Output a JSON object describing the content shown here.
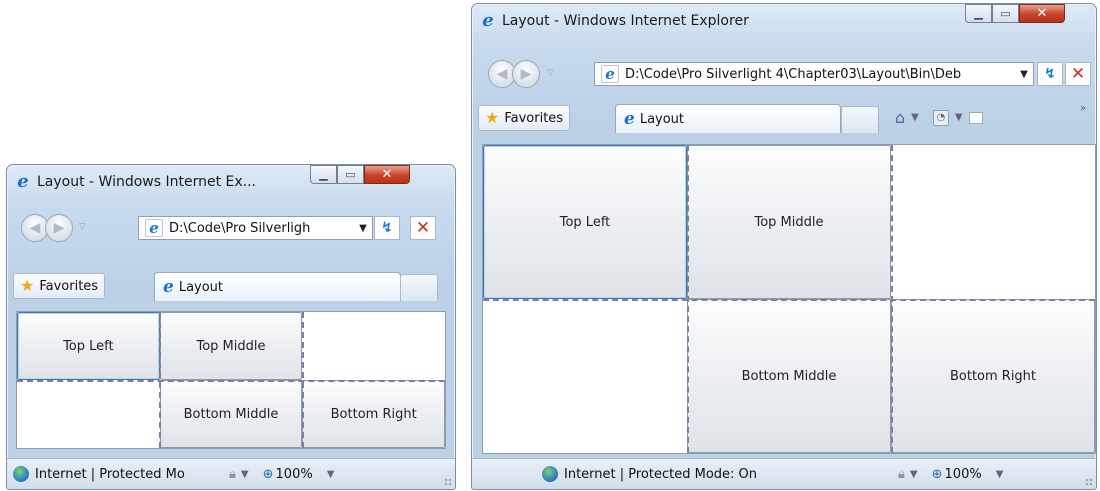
{
  "small_window": {
    "title": "Layout - Windows Internet Ex...",
    "address": "D:\\Code\\Pro Silverligh",
    "favorites_label": "Favorites",
    "tab_label": "Layout",
    "buttons": {
      "top_left": "Top Left",
      "top_middle": "Top Middle",
      "bottom_middle": "Bottom Middle",
      "bottom_right": "Bottom Right"
    },
    "status_text": "Internet | Protected Mo",
    "zoom": "100%"
  },
  "large_window": {
    "title": "Layout - Windows Internet Explorer",
    "address": "D:\\Code\\Pro Silverlight 4\\Chapter03\\Layout\\Bin\\Deb",
    "favorites_label": "Favorites",
    "tab_label": "Layout",
    "buttons": {
      "top_left": "Top Left",
      "top_middle": "Top Middle",
      "bottom_middle": "Bottom Middle",
      "bottom_right": "Bottom Right"
    },
    "status_text": "Internet | Protected Mode: On",
    "zoom": "100%"
  },
  "icons": {
    "app": "internet-explorer-icon",
    "back": "back-arrow-icon",
    "forward": "forward-arrow-icon",
    "refresh": "refresh-icon",
    "stop": "stop-icon",
    "favorites": "star-icon",
    "home": "home-icon",
    "feeds": "rss-icon",
    "read_mail": "mail-icon",
    "zone": "security-zone-icon",
    "zoom": "magnifier-icon"
  },
  "colors": {
    "frame": "#c8daee",
    "close_button": "#c7432a",
    "gridline_yellow": "#c8b43a",
    "gridline_blue": "#5a6bd0"
  }
}
